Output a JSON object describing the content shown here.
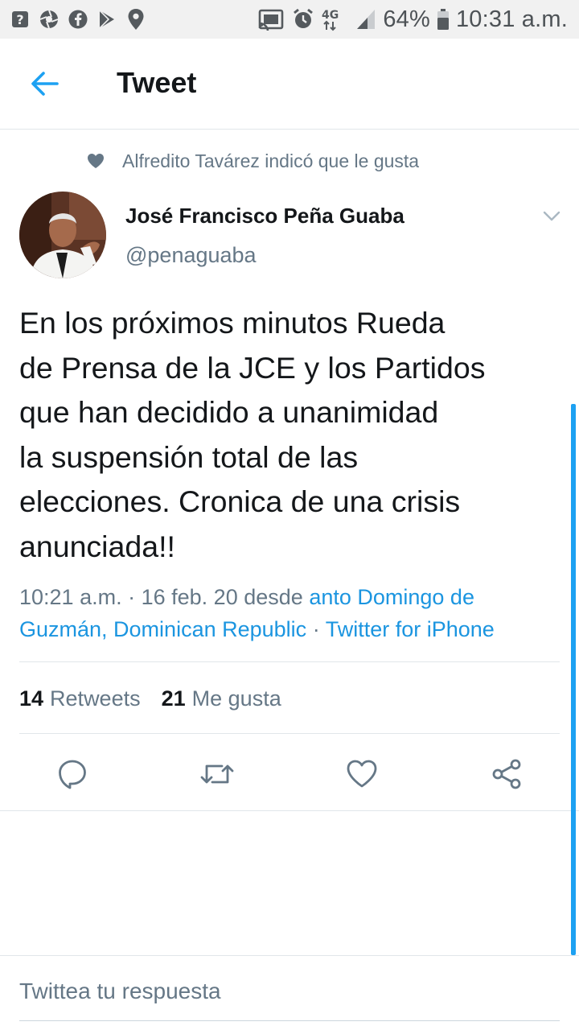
{
  "status_bar": {
    "icons_left": [
      "help-icon",
      "aperture-icon",
      "facebook-icon",
      "play-store-icon",
      "location-icon"
    ],
    "icons_right": [
      "cast-icon",
      "alarm-icon",
      "lte-icon",
      "signal-icon",
      "battery-icon"
    ],
    "network_label": "4G",
    "battery_percent": "64%",
    "time": "10:31 a.m."
  },
  "header": {
    "title": "Tweet",
    "back_icon": "arrow-left-icon"
  },
  "social_context": {
    "icon": "heart-filled-icon",
    "text": "Alfredito Tavárez indicó que le gusta"
  },
  "author": {
    "name": "José Francisco Peña Guaba",
    "handle": "@penaguaba"
  },
  "tweet": {
    "text": "En los próximos minutos Rueda\nde Prensa de la JCE y los Partidos\nque han decidido a unanimidad\nla suspensión total de las\nelecciones. Cronica de una crisis\nanunciada!!",
    "time": "10:21 a.m.",
    "separator": "·",
    "date": "16 feb. 20",
    "from_word": "desde",
    "location": "anto Domingo de Guzmán, Dominican Republic",
    "source": "Twitter for iPhone"
  },
  "stats": {
    "retweets_count": "14",
    "retweets_label": "Retweets",
    "likes_count": "21",
    "likes_label": "Me gusta"
  },
  "actions": [
    "reply-icon",
    "retweet-icon",
    "like-icon",
    "share-icon"
  ],
  "reply_box": {
    "placeholder": "Twittea tu respuesta"
  },
  "colors": {
    "accent": "#1da1f2",
    "link": "#1b95e0",
    "text_primary": "#14171a",
    "text_secondary": "#657786",
    "divider": "#e1e6ea",
    "status_bar_bg": "#f1f1f1"
  }
}
